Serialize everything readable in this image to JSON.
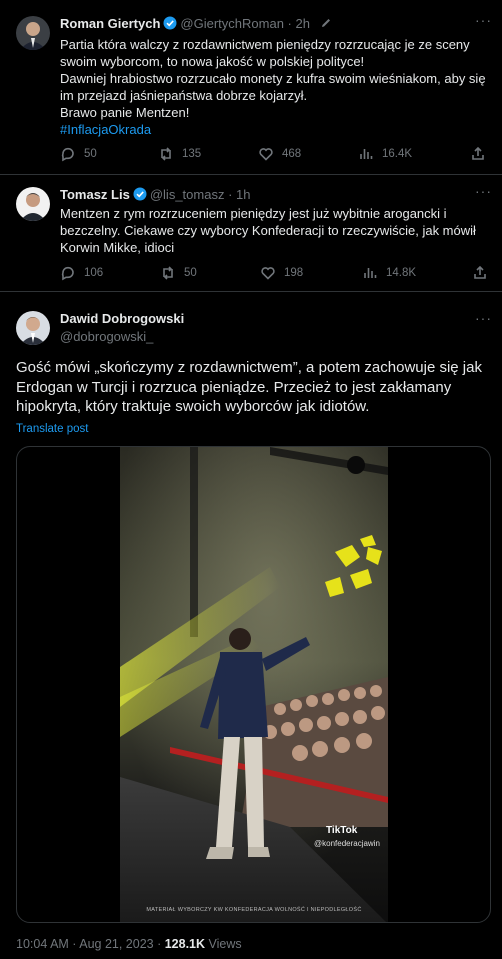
{
  "tweets": [
    {
      "name": "Roman Giertych",
      "handle": "@GiertychRoman",
      "time": "2h",
      "body_lines": [
        "Partia która walczy z rozdawnictwem pieniędzy rozrzucając je ze sceny",
        "swoim wyborcom, to nowa jakość w polskiej polityce!",
        "Dawniej hrabiostwo rozrzucało monety z kufra swoim wieśniakom, aby się",
        "im przejazd jaśniepaństwa dobrze kojarzył.",
        "Brawo panie Mentzen!"
      ],
      "hashtag": "#InflacjaOkrada",
      "replies": "50",
      "retweets": "135",
      "likes": "468",
      "views": "16.4K"
    },
    {
      "name": "Tomasz Lis",
      "handle": "@lis_tomasz",
      "time": "1h",
      "body_lines": [
        "Mentzen z rym rozrzuceniem pieniędzy jest już wybitnie arogancki i",
        "bezczelny. Ciekawe czy wyborcy Konfederacji to rzeczywiście, jak mówił",
        "Korwin Mikke, idioci"
      ],
      "replies": "106",
      "retweets": "50",
      "likes": "198",
      "views": "14.8K"
    }
  ],
  "main": {
    "name": "Dawid Dobrogowski",
    "handle": "@dobrogowski_",
    "text_lines": [
      "Gość mówi „skończymy z rozdawnictwem”, a potem zachowuje się jak",
      "Erdogan w Turcji i rozrzuca pieniądze. Przecież to jest zakłamany",
      "hipokryta, który traktuje swoich wyborców jak idiotów."
    ],
    "translate": "Translate post",
    "video": {
      "tiktok_label": "TikTok",
      "tiktok_handle": "@konfederacjawin",
      "watermark": "MATERIAŁ WYBORCZY KW KONFEDERACJA WOLNOŚĆ I NIEPODLEGŁOŚĆ"
    },
    "timestamp": "10:04 AM · Aug 21, 2023 · ",
    "views_count": "128.1K",
    "views_label": " Views"
  },
  "colors": {
    "background": "#000000",
    "accent": "#1d9bf0",
    "muted": "#71767b",
    "divider": "#2f3336"
  }
}
